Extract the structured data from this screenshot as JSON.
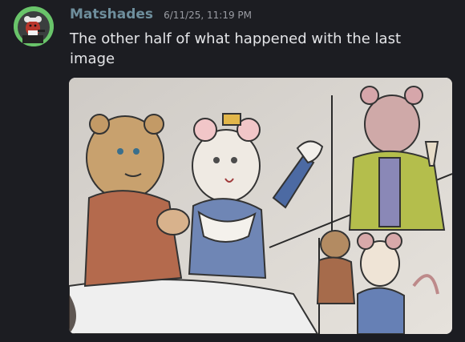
{
  "message": {
    "author": "Matshades",
    "timestamp": "6/11/25, 11:19 PM",
    "text": "The other half of what happened with the last image",
    "avatar_icon": "avatar-image",
    "attachment_icon": "image-attachment"
  },
  "colors": {
    "background": "#1c1d22",
    "username": "#6e8e9c",
    "timestamp": "#9a9ca3",
    "text": "#e4e5e8",
    "avatar_ring": "#69c46a"
  }
}
